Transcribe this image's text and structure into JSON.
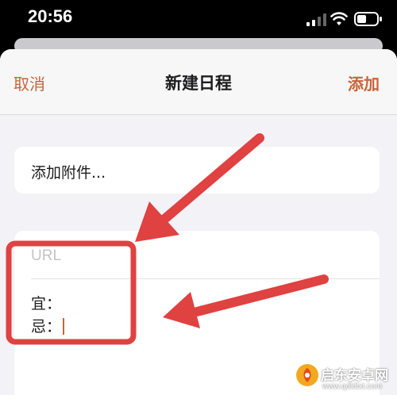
{
  "status_bar": {
    "time": "20:56"
  },
  "nav": {
    "cancel_label": "取消",
    "title": "新建日程",
    "add_label": "添加"
  },
  "attachment": {
    "label": "添加附件..."
  },
  "notes": {
    "url_placeholder": "URL",
    "line1": "宜：",
    "line2": "忌："
  },
  "watermark": {
    "text": "启东安卓网",
    "url": "www.qdldtxt.com"
  },
  "colors": {
    "accent": "#c8643a",
    "annotation": "#e04141",
    "background": "#f2f2f7"
  }
}
